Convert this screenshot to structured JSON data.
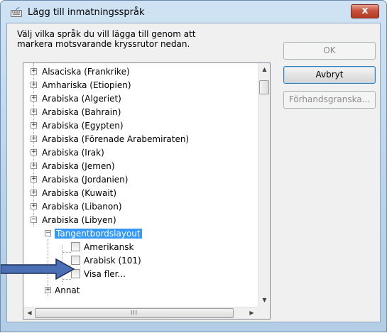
{
  "window": {
    "title": "Lägg till inmatningsspråk",
    "close_label": "x"
  },
  "instruction": "Välj vilka språk du vill lägga till genom att markera motsvarande kryssrutor nedan.",
  "buttons": {
    "ok": "OK",
    "cancel": "Avbryt",
    "preview": "Förhandsgranska..."
  },
  "tree": {
    "languages": [
      "Alsaciska (Frankrike)",
      "Amhariska (Etiopien)",
      "Arabiska (Algeriet)",
      "Arabiska (Bahrain)",
      "Arabiska (Egypten)",
      "Arabiska (Förenade Arabemiraten)",
      "Arabiska (Irak)",
      "Arabiska (Jemen)",
      "Arabiska (Jordanien)",
      "Arabiska (Kuwait)",
      "Arabiska (Libanon)",
      "Arabiska (Libyen)"
    ],
    "keyboard_group": "Tangentbordslayout",
    "layouts": [
      "Amerikansk",
      "Arabisk (101)",
      "Visa fler..."
    ],
    "other_group": "Annat"
  },
  "icons": {
    "app": "keyboard-icon",
    "close": "close-icon",
    "expand": "plus-box-icon",
    "collapse": "minus-box-icon",
    "pointer": "arrow-pointer-icon"
  },
  "colors": {
    "selection": "#3399ff",
    "close_button": "#c8523c",
    "pointer_arrow": "#4a6fb5"
  }
}
